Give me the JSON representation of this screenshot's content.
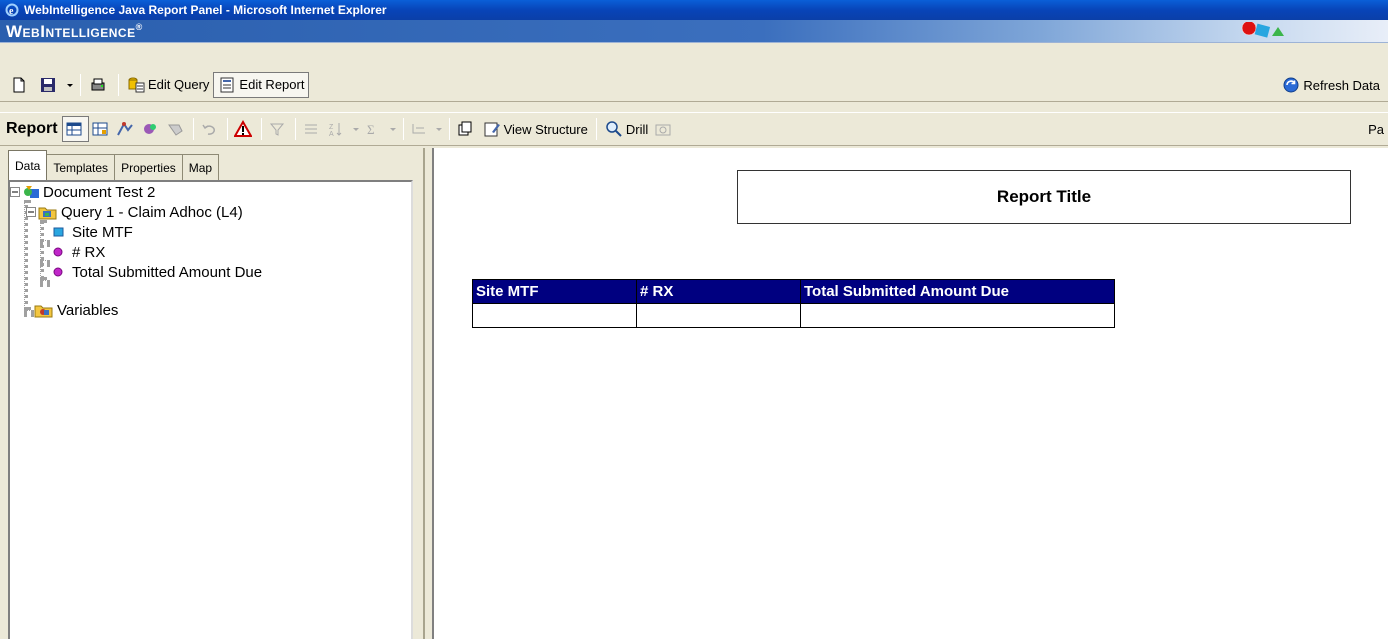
{
  "window": {
    "title": "WebIntelligence Java Report Panel - Microsoft Internet Explorer"
  },
  "brand": {
    "name": "WebIntelligence",
    "mark": "®"
  },
  "toolbar1": {
    "edit_query": "Edit Query",
    "edit_report": "Edit Report",
    "refresh_data": "Refresh Data"
  },
  "toolbar2": {
    "report_label": "Report",
    "view_structure": "View Structure",
    "drill": "Drill",
    "page_label": "Pa"
  },
  "leftpanel": {
    "tabs": [
      "Data",
      "Templates",
      "Properties",
      "Map"
    ],
    "active_tab": "Data",
    "tree": {
      "document": "Document Test 2",
      "query": "Query 1 - Claim Adhoc (L4)",
      "objects": [
        "Site MTF",
        "# RX",
        "Total Submitted Amount Due"
      ],
      "variables": "Variables"
    }
  },
  "report": {
    "title": "Report Title",
    "table": {
      "columns": [
        "Site MTF",
        "# RX",
        "Total Submitted Amount Due"
      ],
      "rows": [
        [
          "",
          "",
          ""
        ]
      ]
    }
  },
  "colors": {
    "table_header": "#000080",
    "titlebar": "#0a5fd8"
  }
}
